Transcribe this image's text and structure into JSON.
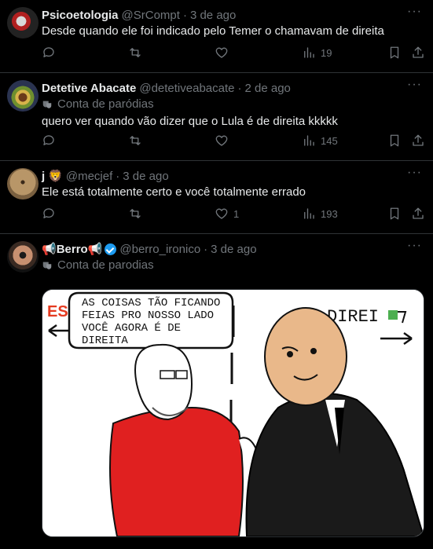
{
  "tweets": [
    {
      "name": "Psicoetologia",
      "handle": "@SrCompt",
      "time": "3 de ago",
      "parody": "",
      "text": "Desde quando ele foi indicado pelo Temer o chamavam de direita",
      "replies": "",
      "reposts": "",
      "likes": "",
      "views": "19"
    },
    {
      "name": "Detetive Abacate",
      "handle": "@detetiveabacate",
      "time": "2 de ago",
      "parody": "Conta de paródias",
      "text": "quero ver quando vão dizer que o Lula é de direita kkkkk",
      "replies": "",
      "reposts": "",
      "likes": "",
      "views": "145"
    },
    {
      "name": "j",
      "name_emoji": "🦁",
      "handle": "@mecjef",
      "time": "3 de ago",
      "parody": "",
      "text": "Ele está totalmente certo e você totalmente errado",
      "replies": "",
      "reposts": "",
      "likes": "1",
      "views": "193"
    },
    {
      "name": "Berro",
      "name_emoji_left": "📢",
      "name_emoji_right": "📢",
      "handle": "@berro_ironico",
      "time": "3 de ago",
      "parody": "Conta de parodias",
      "text": "",
      "media": {
        "left_label": "ES",
        "right_label": "DIREI",
        "speech": [
          "AS COISAS TÃO FICANDO",
          "FEIAS PRO NOSSO LADO",
          "VOCÊ AGORA É DE",
          "DIREITA"
        ]
      }
    }
  ],
  "dot": "·",
  "more": "···"
}
